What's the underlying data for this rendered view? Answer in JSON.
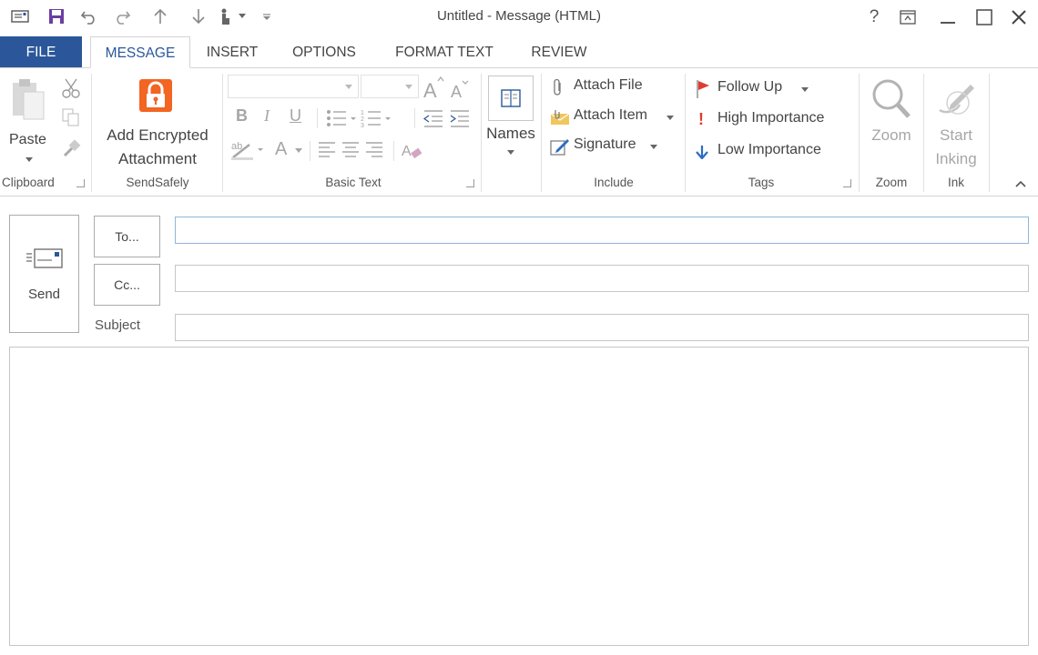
{
  "window": {
    "title": "Untitled - Message (HTML)",
    "help": "?"
  },
  "tabs": [
    {
      "label": "FILE"
    },
    {
      "label": "MESSAGE"
    },
    {
      "label": "INSERT"
    },
    {
      "label": "OPTIONS"
    },
    {
      "label": "FORMAT TEXT"
    },
    {
      "label": "REVIEW"
    }
  ],
  "ribbon": {
    "clipboard": {
      "paste": "Paste",
      "label": "Clipboard"
    },
    "sendsafely": {
      "line1": "Add Encrypted",
      "line2": "Attachment",
      "label": "SendSafely"
    },
    "basic_text": {
      "label": "Basic Text",
      "bold": "B",
      "italic": "I",
      "underline": "U",
      "font_color": "A"
    },
    "names": {
      "label": "Names"
    },
    "include": {
      "attach_file": "Attach File",
      "attach_item": "Attach Item",
      "signature": "Signature",
      "label": "Include"
    },
    "tags": {
      "follow_up": "Follow Up",
      "high_importance": "High Importance",
      "low_importance": "Low Importance",
      "label": "Tags",
      "high_mark": "!",
      "follow_color": "#e03c31",
      "high_color": "#e03c31",
      "low_color": "#2b6cc4"
    },
    "zoom": {
      "button": "Zoom",
      "label": "Zoom"
    },
    "ink": {
      "line1": "Start",
      "line2": "Inking",
      "label": "Ink"
    }
  },
  "compose": {
    "send": "Send",
    "to": "To...",
    "cc": "Cc...",
    "subject": "Subject",
    "to_value": "",
    "cc_value": "",
    "subject_value": ""
  },
  "colors": {
    "accent": "#2b579a",
    "sendsafely": "#f26522"
  }
}
